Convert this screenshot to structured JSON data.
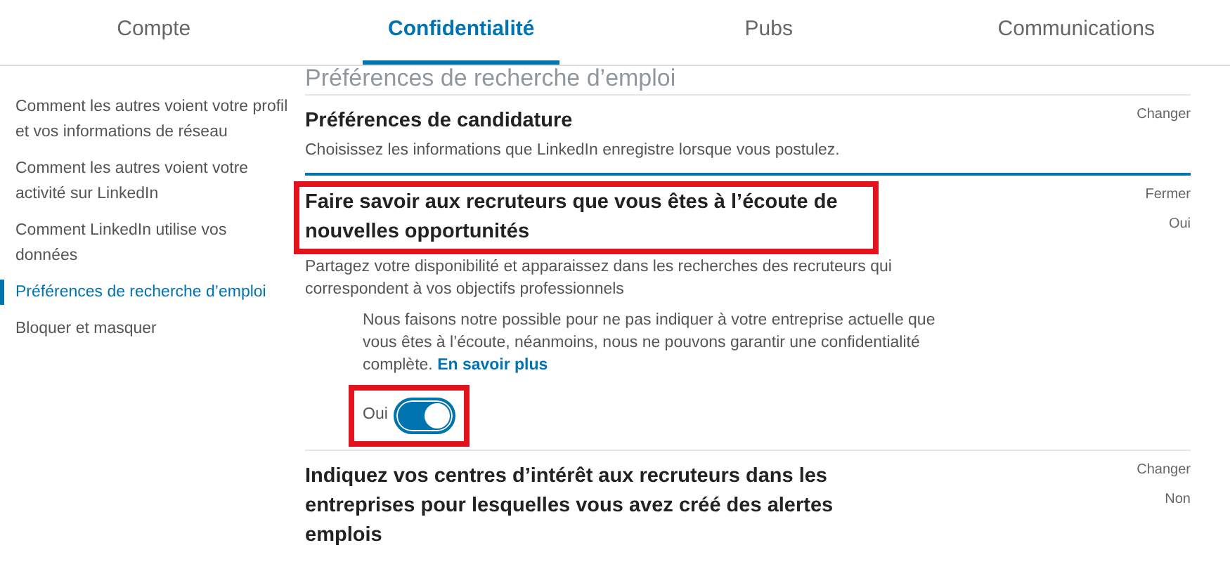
{
  "tabs": [
    {
      "label": "Compte",
      "selected": false
    },
    {
      "label": "Confidentialité",
      "selected": true
    },
    {
      "label": "Pubs",
      "selected": false
    },
    {
      "label": "Communications",
      "selected": false
    }
  ],
  "sidebar": {
    "items": [
      {
        "label": "Comment les autres voient votre profil et vos informations de réseau",
        "selected": false
      },
      {
        "label": "Comment les autres voient votre activité sur LinkedIn",
        "selected": false
      },
      {
        "label": "Comment LinkedIn utilise vos données",
        "selected": false
      },
      {
        "label": "Préférences de recherche d’emploi",
        "selected": true
      },
      {
        "label": "Bloquer et masquer",
        "selected": false
      }
    ]
  },
  "page_heading": "Préférences de recherche d’emploi",
  "sections": [
    {
      "title": "Préférences de candidature",
      "description": "Choisissez les informations que LinkedIn enregistre lorsque vous postulez.",
      "action": "Changer",
      "expanded": false,
      "highlighted": false
    },
    {
      "title": "Faire savoir aux recruteurs que vous êtes à l’écoute de nouvelles opportunités",
      "description": "Partagez votre disponibilité et apparaissez dans les recherches des recruteurs qui correspondent à vos objectifs professionnels",
      "action": "Fermer",
      "value": "Oui",
      "expanded": true,
      "highlighted": true,
      "note": "Nous faisons notre possible pour ne pas indiquer à votre entreprise actuelle que vous êtes à l’écoute, néanmoins, nous ne pouvons garantir une confidentialité complète.",
      "note_link": "En savoir plus",
      "toggle": {
        "label": "Oui",
        "on": true,
        "highlighted": true
      }
    },
    {
      "title": "Indiquez vos centres d’intérêt aux recruteurs dans les entreprises pour lesquelles vous avez créé des alertes emplois",
      "action": "Changer",
      "value": "Non",
      "expanded": false,
      "highlighted": false
    }
  ]
}
